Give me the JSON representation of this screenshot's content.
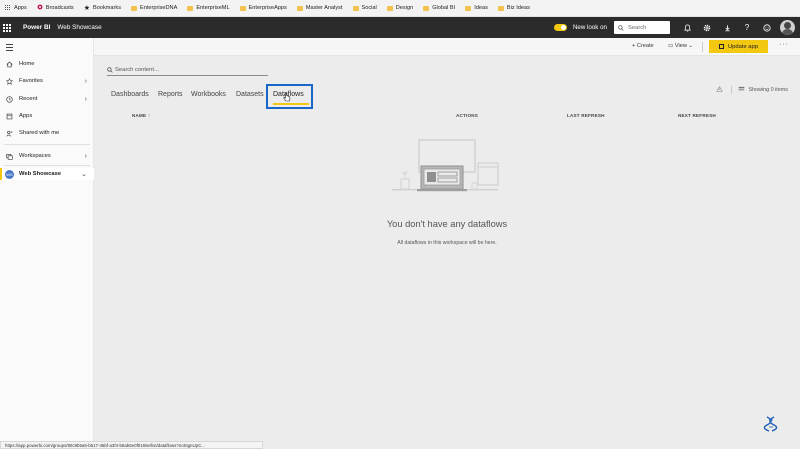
{
  "bookmarks_bar": {
    "items": [
      {
        "label": "Apps",
        "icon": "apps-grid-icon"
      },
      {
        "label": "Broadcasts",
        "icon": "broadcasts-icon"
      },
      {
        "label": "Bookmarks",
        "icon": "star-icon"
      },
      {
        "label": "EnterpriseDNA",
        "icon": "folder-icon"
      },
      {
        "label": "EnterpriseML",
        "icon": "folder-icon"
      },
      {
        "label": "EnterpriseApps",
        "icon": "folder-icon"
      },
      {
        "label": "Master Analyst",
        "icon": "folder-icon"
      },
      {
        "label": "Social",
        "icon": "folder-icon"
      },
      {
        "label": "Design",
        "icon": "folder-icon"
      },
      {
        "label": "Global BI",
        "icon": "folder-icon"
      },
      {
        "label": "Ideas",
        "icon": "folder-icon"
      },
      {
        "label": "Biz Ideas",
        "icon": "folder-icon"
      }
    ]
  },
  "header": {
    "brand": "Power BI",
    "workspace_title": "Web Showcase",
    "new_look_label": "New look on",
    "search_placeholder": "Search",
    "icons": [
      "bell-icon",
      "settings-icon",
      "download-icon",
      "help-icon",
      "smiley-icon"
    ],
    "accent": "#f2c811"
  },
  "sidebar": {
    "items": [
      {
        "label": "Home",
        "icon": "home-icon"
      },
      {
        "label": "Favorites",
        "icon": "star-icon",
        "chevron": "›"
      },
      {
        "label": "Recent",
        "icon": "clock-icon",
        "chevron": "›"
      },
      {
        "label": "Apps",
        "icon": "apps-icon"
      },
      {
        "label": "Shared with me",
        "icon": "shared-icon"
      },
      {
        "label": "Workspaces",
        "icon": "workspaces-icon",
        "chevron": "›"
      },
      {
        "label": "Web Showcase",
        "icon": "workspace-avatar-icon",
        "chevron": "⌄",
        "active": true
      }
    ],
    "workspace_badge": "WS"
  },
  "commandbar": {
    "create_label": "Create",
    "view_label": "View",
    "update_app_label": "Update app",
    "more_label": "···"
  },
  "main": {
    "search_placeholder": "Search content...",
    "tabs": [
      {
        "label": "Dashboards"
      },
      {
        "label": "Reports"
      },
      {
        "label": "Workbooks"
      },
      {
        "label": "Datasets"
      },
      {
        "label": "Dataflows",
        "active": true
      }
    ],
    "showing_label": "Showing 0 items",
    "columns": {
      "name": "NAME",
      "sort_arrow": "↑",
      "actions": "ACTIONS",
      "last_refresh": "LAST REFRESH",
      "next_refresh": "NEXT REFRESH"
    },
    "empty_state": {
      "title": "You don't have any dataflows",
      "subtitle": "All dataflows in this workspace will be here."
    }
  },
  "status_bar": {
    "url": "https://app.powerbi.com/groups/90c9b5a5-b517-46bf-a3f4-b8ab6e0f0165e/list/dataflows?noSignUpC..."
  }
}
